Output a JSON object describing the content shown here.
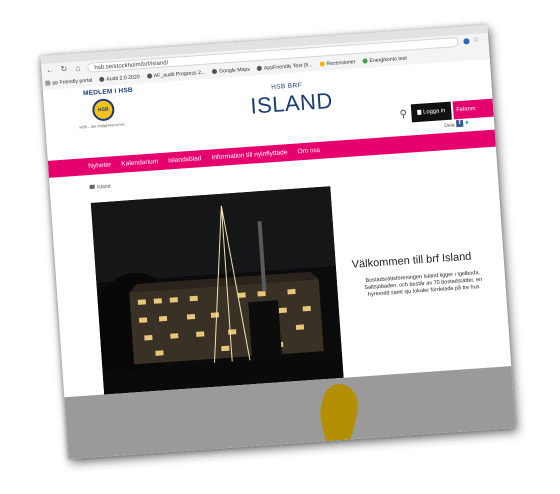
{
  "browser": {
    "url": "hsb.se/stockholm/brf/island/",
    "bookmarks": [
      {
        "label": "pp Friendly portal",
        "icon": "gear-icon"
      },
      {
        "label": "Audit 2.0 2020",
        "icon": "chrome-icon"
      },
      {
        "label": "AF_audit Progress 2...",
        "icon": "chrome-icon"
      },
      {
        "label": "Google Maps",
        "icon": "chrome-icon"
      },
      {
        "label": "AppFriendly Test (fi...",
        "icon": "chrome-icon"
      },
      {
        "label": "Recensioner",
        "icon": "doc-icon"
      },
      {
        "label": "Energikonto test",
        "icon": "leaf-icon"
      }
    ]
  },
  "header": {
    "member": "MEDLEM I HSB",
    "tagline": "HSB – där möjligheterna bor",
    "brf_label": "HSB BRF",
    "title": "ISLAND",
    "login": "Logga in",
    "report": "Felanm",
    "share": "Dela"
  },
  "nav": {
    "items": [
      "Nyheter",
      "Kalendarium",
      "Islandsblad",
      "Information till nyinflyttade",
      "Om oss"
    ]
  },
  "breadcrumb": "Island",
  "hero": {
    "heading": "Välkommen till brf Island",
    "text": "Bostadsrättsföreningen Island ligger i Igelboda, Saltsjöbaden, och består av 70 bostadsrätter, en hyresrätt samt sju lokaler fördelade på tre hus"
  },
  "colors": {
    "accent": "#e6006e",
    "brand": "#1b3c73",
    "login_bg": "#111111",
    "bottom_bar": "#9a9a9a",
    "blob": "#b38f00"
  }
}
